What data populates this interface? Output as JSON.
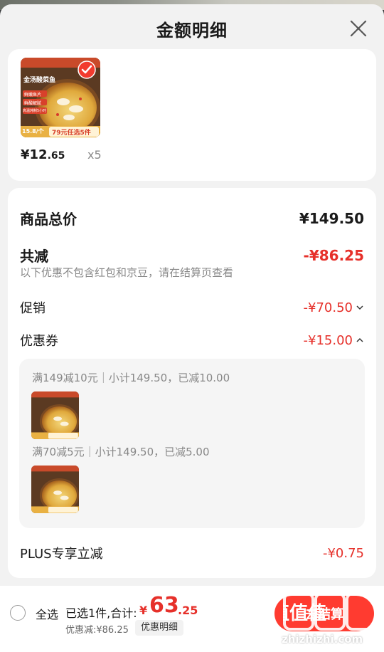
{
  "sheet": {
    "title": "金额明细"
  },
  "product": {
    "thumb_title": "金汤酸菜鱼",
    "thumb_tags": [
      "鲜嫩鱼片",
      "鲜酸解腻",
      "高温炖制5小时"
    ],
    "thumb_price_tag": "15.8/个",
    "thumb_promo": "79元任选5件",
    "price_symbol": "¥",
    "price_int": "12",
    "price_dec": ".65",
    "quantity": "x5"
  },
  "summary": {
    "goods_total_label": "商品总价",
    "goods_total_value": "¥149.50",
    "reduction_label": "共减",
    "reduction_value": "-¥86.25",
    "note": "以下优惠不包含红包和京豆，请在结算页查看",
    "promo_label": "促销",
    "promo_value": "-¥70.50",
    "coupon_label": "优惠券",
    "coupon_value": "-¥15.00",
    "coupons": [
      {
        "text": "满149减10元｜小计149.50，已减10.00"
      },
      {
        "text": "满70减5元｜小计149.50，已减5.00"
      }
    ],
    "plus_label": "PLUS专享立减",
    "plus_value": "-¥0.75"
  },
  "footer": {
    "select_all": "全选",
    "selected_text": "已选1件,合计:",
    "total_symbol": "¥",
    "total_int": "63",
    "total_dec": ".25",
    "discount_text": "优惠减:¥86.25",
    "detail_link": "优惠明细",
    "checkout": "去结算"
  },
  "watermark": {
    "text": "zhizhizhi.com",
    "logo": "值值值"
  },
  "colors": {
    "accent": "#e6302a",
    "button": "#ff3b30",
    "sheet_bg": "#f2f2f2"
  }
}
